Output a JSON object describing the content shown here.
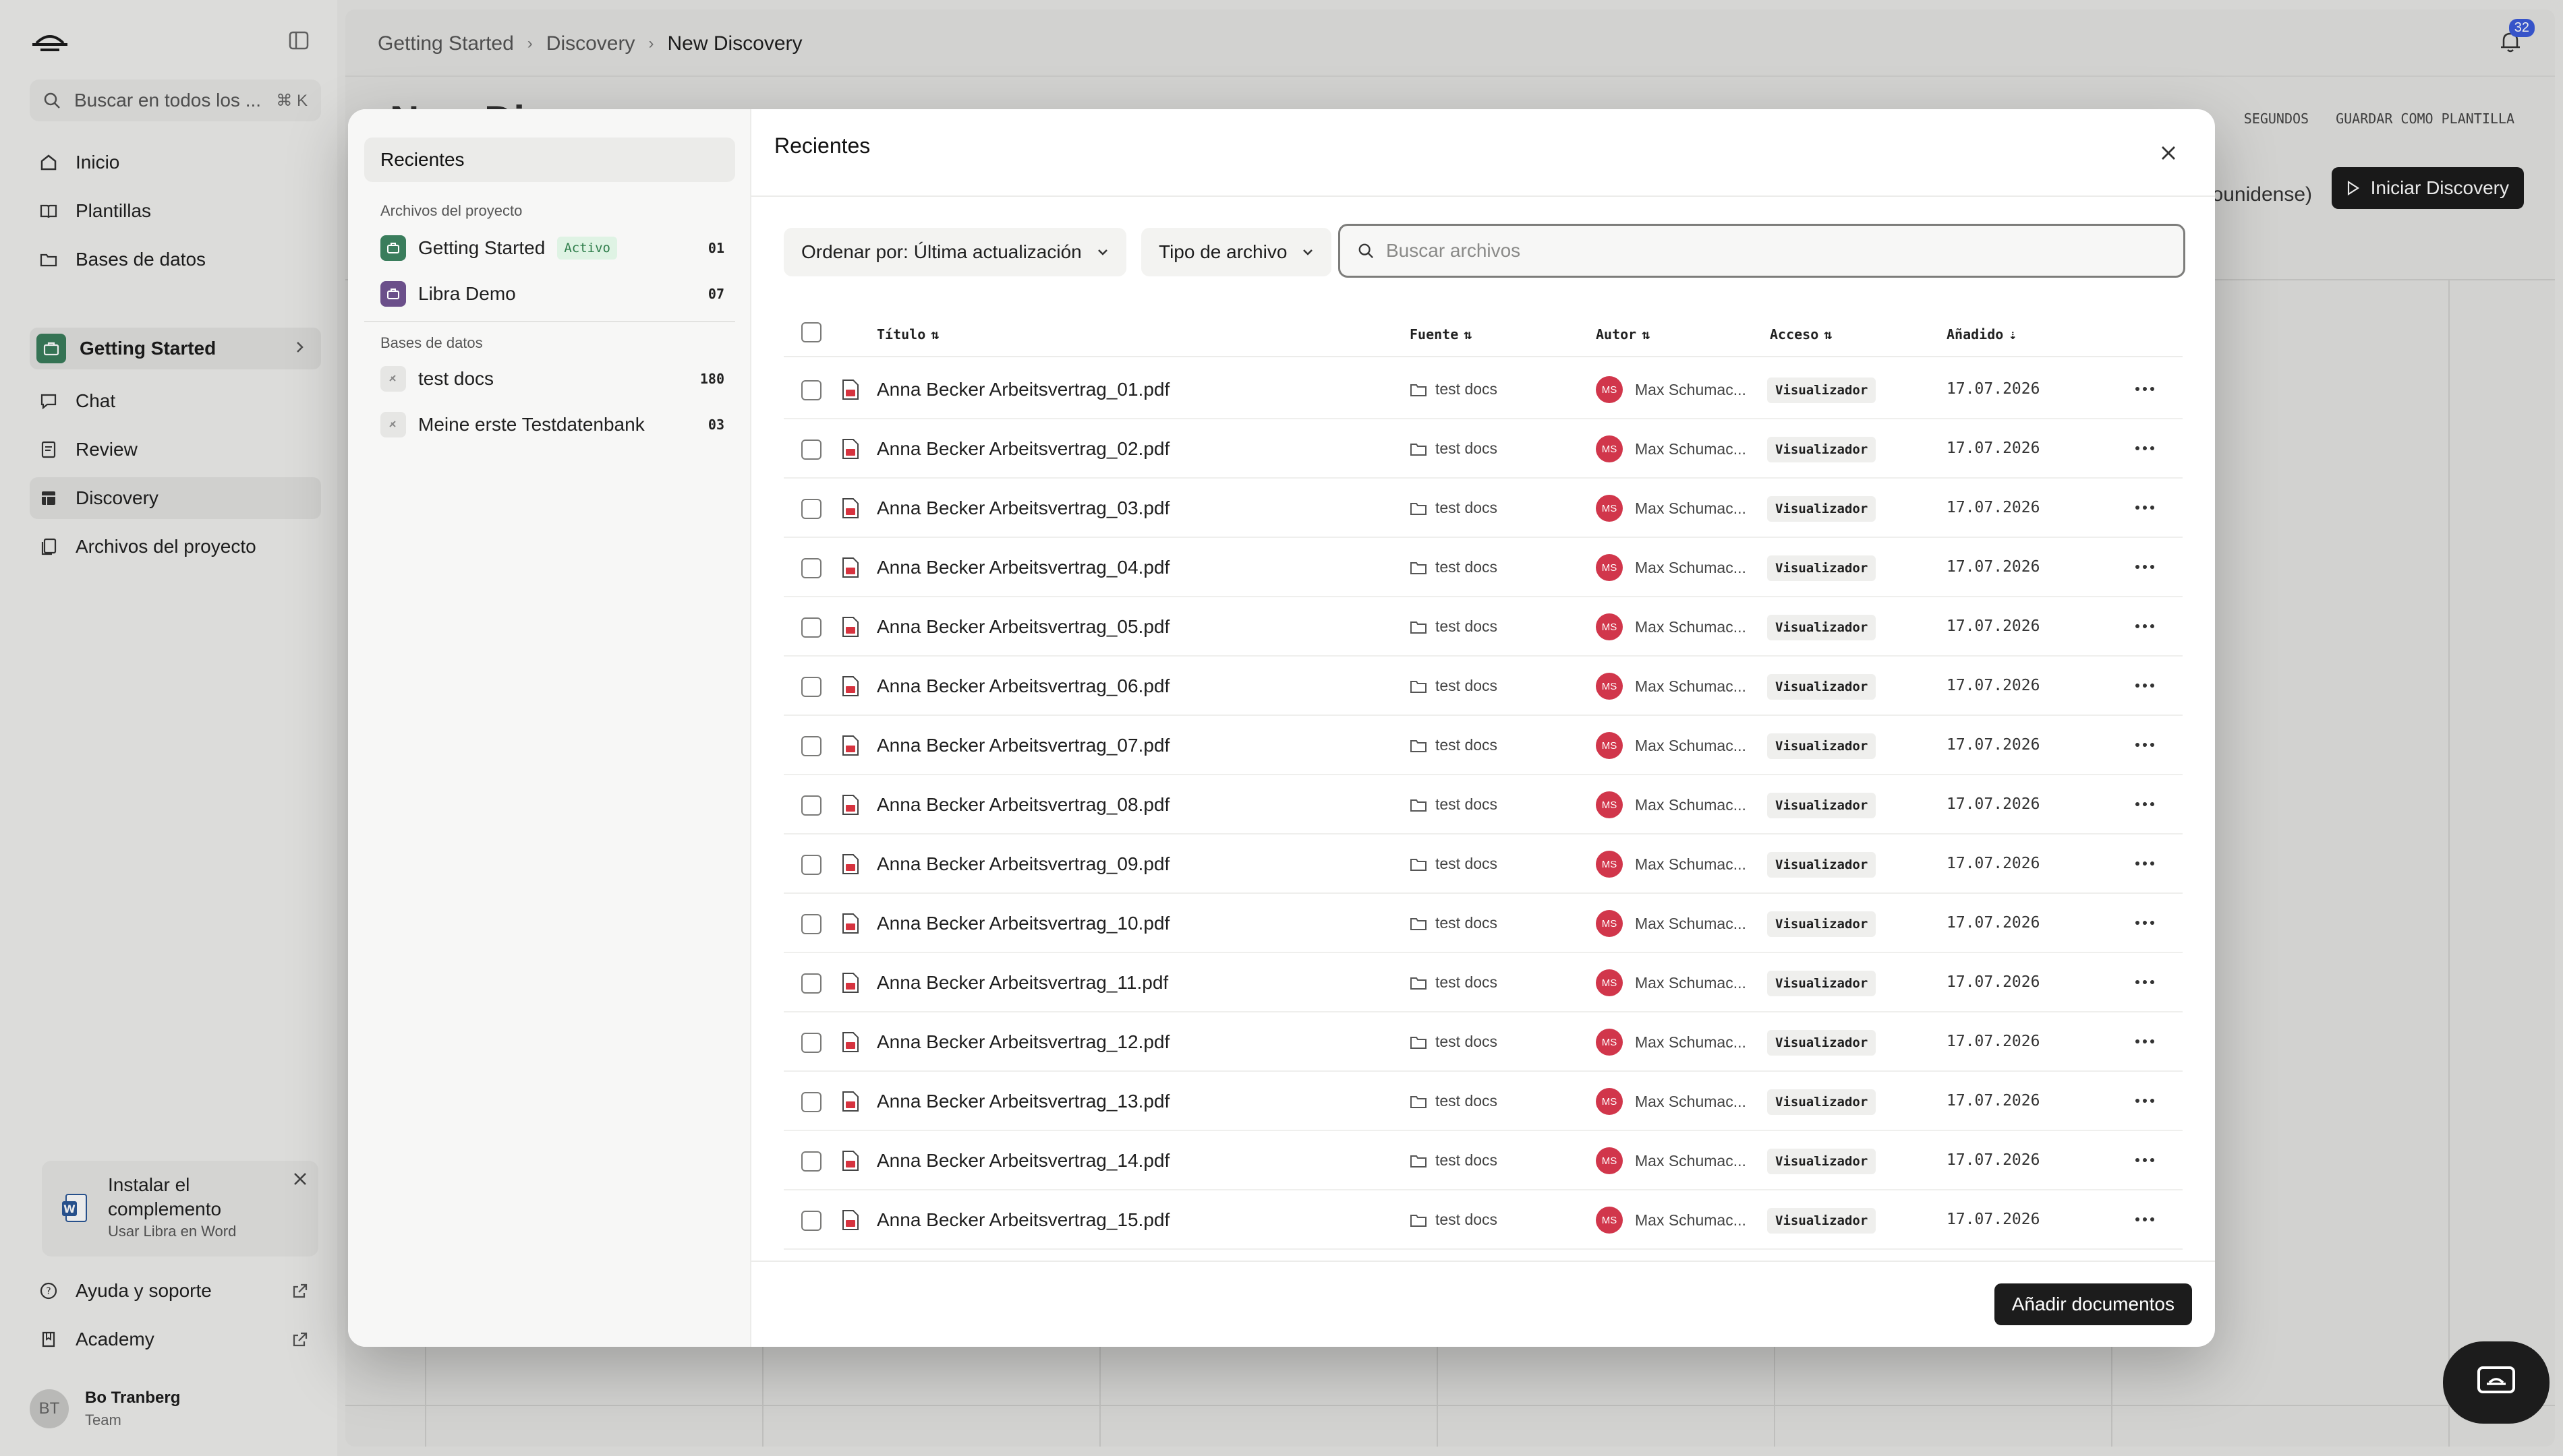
{
  "sidebar": {
    "search_placeholder": "Buscar en todos los ...",
    "search_shortcut": "⌘ K",
    "nav": [
      {
        "label": "Inicio",
        "icon": "home-icon"
      },
      {
        "label": "Plantillas",
        "icon": "book-icon"
      },
      {
        "label": "Bases de datos",
        "icon": "folder-icon"
      }
    ],
    "project": {
      "label": "Getting Started"
    },
    "project_nav": [
      {
        "label": "Chat",
        "icon": "chat-icon"
      },
      {
        "label": "Review",
        "icon": "review-icon"
      },
      {
        "label": "Discovery",
        "icon": "table-icon"
      },
      {
        "label": "Archivos del proyecto",
        "icon": "files-icon"
      }
    ],
    "promo": {
      "title": "Instalar el complemento",
      "subtitle": "Usar Libra en Word"
    },
    "footer_links": [
      {
        "label": "Ayuda y soporte",
        "icon": "help-icon"
      },
      {
        "label": "Academy",
        "icon": "academy-icon"
      }
    ],
    "user": {
      "initials": "BT",
      "name": "Bo Tranberg",
      "role": "Team"
    }
  },
  "main": {
    "breadcrumbs": [
      "Getting Started",
      "Discovery",
      "New Discovery"
    ],
    "notification_count": "32",
    "page_title": "New Di",
    "actions": [
      "SEGUNDOS",
      "GUARDAR COMO PLANTILLA"
    ],
    "language_label": "ounidense)",
    "start_label": "Iniciar Discovery"
  },
  "modal": {
    "title": "Recientes",
    "left": {
      "recent_label": "Recientes",
      "section_project": "Archivos del proyecto",
      "section_db": "Bases de datos",
      "active_label": "Activo",
      "project_files": [
        {
          "label": "Getting Started",
          "count": "01",
          "color": "#3a7d5c",
          "active": true
        },
        {
          "label": "Libra Demo",
          "count": "07",
          "color": "#6b4f8a",
          "active": false
        }
      ],
      "databases": [
        {
          "label": "test docs",
          "count": "180"
        },
        {
          "label": "Meine erste Testdatenbank",
          "count": "03"
        }
      ]
    },
    "sort_prefix": "Ordenar por:",
    "sort_value": "Última actualización",
    "type_filter": "Tipo de archivo",
    "search_placeholder": "Buscar archivos",
    "columns": {
      "title": "Título",
      "source": "Fuente",
      "author": "Autor",
      "access": "Acceso",
      "added": "Añadido"
    },
    "rows": [
      {
        "title": "Anna Becker Arbeitsvertrag_01.pdf",
        "source": "test docs",
        "author_initials": "MS",
        "author": "Max Schumac...",
        "access": "Visualizador",
        "added": "17.07.2026"
      },
      {
        "title": "Anna Becker Arbeitsvertrag_02.pdf",
        "source": "test docs",
        "author_initials": "MS",
        "author": "Max Schumac...",
        "access": "Visualizador",
        "added": "17.07.2026"
      },
      {
        "title": "Anna Becker Arbeitsvertrag_03.pdf",
        "source": "test docs",
        "author_initials": "MS",
        "author": "Max Schumac...",
        "access": "Visualizador",
        "added": "17.07.2026"
      },
      {
        "title": "Anna Becker Arbeitsvertrag_04.pdf",
        "source": "test docs",
        "author_initials": "MS",
        "author": "Max Schumac...",
        "access": "Visualizador",
        "added": "17.07.2026"
      },
      {
        "title": "Anna Becker Arbeitsvertrag_05.pdf",
        "source": "test docs",
        "author_initials": "MS",
        "author": "Max Schumac...",
        "access": "Visualizador",
        "added": "17.07.2026"
      },
      {
        "title": "Anna Becker Arbeitsvertrag_06.pdf",
        "source": "test docs",
        "author_initials": "MS",
        "author": "Max Schumac...",
        "access": "Visualizador",
        "added": "17.07.2026"
      },
      {
        "title": "Anna Becker Arbeitsvertrag_07.pdf",
        "source": "test docs",
        "author_initials": "MS",
        "author": "Max Schumac...",
        "access": "Visualizador",
        "added": "17.07.2026"
      },
      {
        "title": "Anna Becker Arbeitsvertrag_08.pdf",
        "source": "test docs",
        "author_initials": "MS",
        "author": "Max Schumac...",
        "access": "Visualizador",
        "added": "17.07.2026"
      },
      {
        "title": "Anna Becker Arbeitsvertrag_09.pdf",
        "source": "test docs",
        "author_initials": "MS",
        "author": "Max Schumac...",
        "access": "Visualizador",
        "added": "17.07.2026"
      },
      {
        "title": "Anna Becker Arbeitsvertrag_10.pdf",
        "source": "test docs",
        "author_initials": "MS",
        "author": "Max Schumac...",
        "access": "Visualizador",
        "added": "17.07.2026"
      },
      {
        "title": "Anna Becker Arbeitsvertrag_11.pdf",
        "source": "test docs",
        "author_initials": "MS",
        "author": "Max Schumac...",
        "access": "Visualizador",
        "added": "17.07.2026"
      },
      {
        "title": "Anna Becker Arbeitsvertrag_12.pdf",
        "source": "test docs",
        "author_initials": "MS",
        "author": "Max Schumac...",
        "access": "Visualizador",
        "added": "17.07.2026"
      },
      {
        "title": "Anna Becker Arbeitsvertrag_13.pdf",
        "source": "test docs",
        "author_initials": "MS",
        "author": "Max Schumac...",
        "access": "Visualizador",
        "added": "17.07.2026"
      },
      {
        "title": "Anna Becker Arbeitsvertrag_14.pdf",
        "source": "test docs",
        "author_initials": "MS",
        "author": "Max Schumac...",
        "access": "Visualizador",
        "added": "17.07.2026"
      },
      {
        "title": "Anna Becker Arbeitsvertrag_15.pdf",
        "source": "test docs",
        "author_initials": "MS",
        "author": "Max Schumac...",
        "access": "Visualizador",
        "added": "17.07.2026"
      }
    ],
    "add_button": "Añadir documentos"
  }
}
